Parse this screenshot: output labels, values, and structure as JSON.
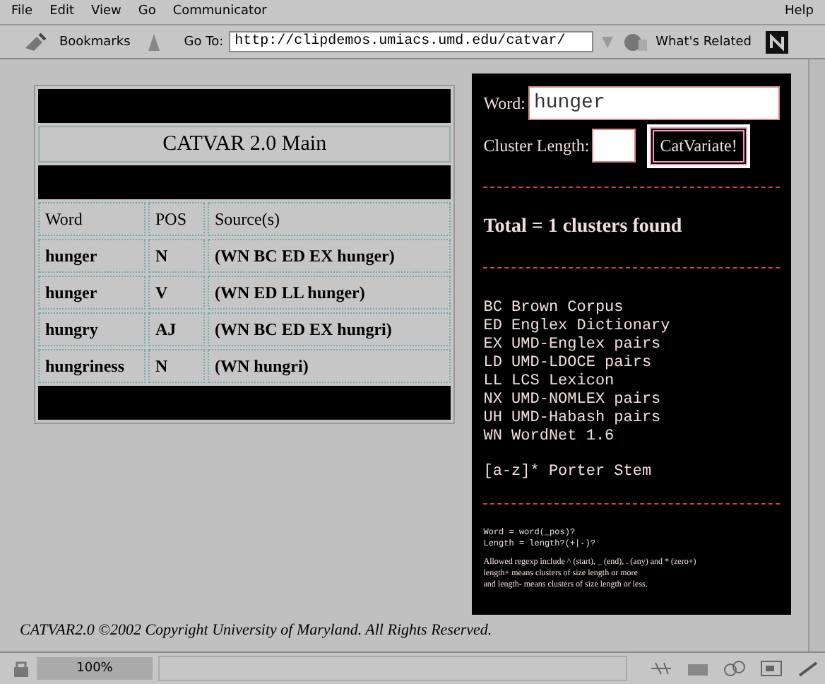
{
  "menu": [
    "File",
    "Edit",
    "View",
    "Go",
    "Communicator"
  ],
  "help_menu": "Help",
  "toolbar": {
    "bookmarks": "Bookmarks",
    "goto_label": "Go To:",
    "url": "http://clipdemos.umiacs.umd.edu/catvar/",
    "related": "What's Related"
  },
  "main": {
    "title": "CATVAR 2.0 Main",
    "columns": [
      "Word",
      "POS",
      "Source(s)"
    ],
    "rows": [
      [
        "hunger",
        "N",
        "(WN BC ED EX hunger)"
      ],
      [
        "hunger",
        "V",
        "(WN ED LL hunger)"
      ],
      [
        "hungry",
        "AJ",
        "(WN BC ED EX hungri)"
      ],
      [
        "hungriness",
        "N",
        "(WN hungri)"
      ]
    ]
  },
  "form": {
    "word_label": "Word:",
    "word_value": "hunger",
    "length_label": "Cluster Length:",
    "button": "CatVariate!"
  },
  "total": "Total = 1 clusters found",
  "legend": [
    "BC Brown Corpus",
    "ED Englex Dictionary",
    "EX UMD-Englex pairs",
    "LD UMD-LDOCE pairs",
    "LL LCS Lexicon",
    "NX UMD-NOMLEX pairs",
    "UH UMD-Habash pairs",
    "WN WordNet 1.6"
  ],
  "stem_note": "[a-z]* Porter Stem",
  "syntax": [
    "Word = word(_pos)?",
    "Length = length?(+|-)?"
  ],
  "help_lines": [
    "Allowed regexp include ^ (start), _ (end), . (any) and * (zero+)",
    "length+ means clusters of size length or more",
    "and length- means clusters of size length or less."
  ],
  "footer": "CATVAR2.0 ©2002 Copyright University of Maryland. All Rights Reserved.",
  "status": {
    "progress": "100%"
  }
}
